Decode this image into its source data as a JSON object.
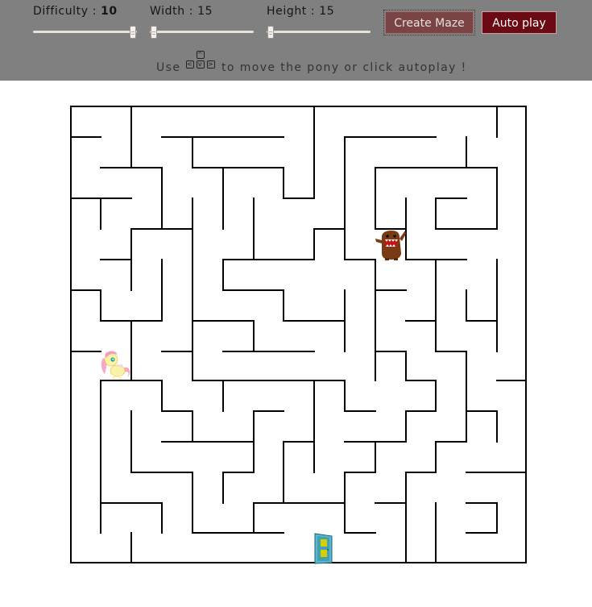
{
  "controls": {
    "difficulty": {
      "label": "Difficulty : ",
      "value": "10",
      "slider_value": 10,
      "slider_min": 1,
      "slider_max": 10
    },
    "width": {
      "label": "Width : 15",
      "slider_value": 15
    },
    "height": {
      "label": "Height : 15",
      "slider_value": 15
    }
  },
  "buttons": {
    "create": "Create Maze",
    "autoplay": "Auto play"
  },
  "hint": {
    "prefix": "Use",
    "suffix": "to move the pony or click autoplay !",
    "keys": [
      "^",
      "<",
      "v",
      ">"
    ]
  },
  "colors": {
    "topbar": "#808080",
    "create_button": "#7a4444",
    "autoplay_button": "#6b0a12",
    "maze_wall": "#000000",
    "background": "#ffffff"
  },
  "maze": {
    "columns": 15,
    "rows": 15,
    "pony": {
      "name": "pony",
      "col": 1,
      "row": 8
    },
    "monster": {
      "name": "domo-monster",
      "col": 10,
      "row": 4
    },
    "exit": {
      "name": "exit-door",
      "col": 8,
      "row": 14
    }
  }
}
